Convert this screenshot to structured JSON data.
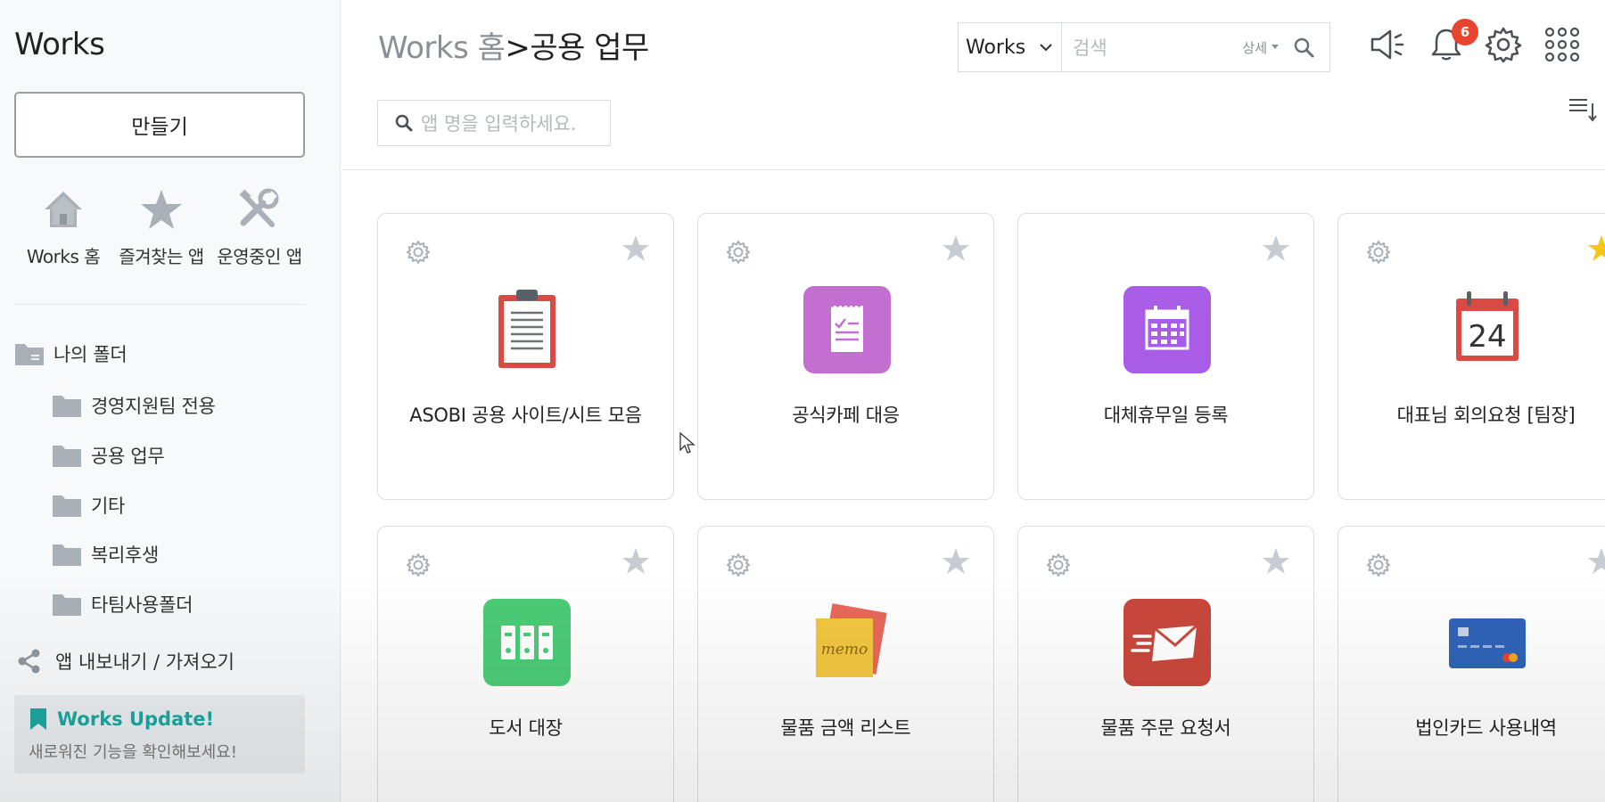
{
  "sidebar": {
    "app_title": "Works",
    "create_label": "만들기",
    "quick_nav": [
      {
        "label": "Works 홈",
        "icon": "home-icon"
      },
      {
        "label": "즐겨찾는 앱",
        "icon": "star-icon"
      },
      {
        "label": "운영중인 앱",
        "icon": "tools-icon"
      }
    ],
    "folders": [
      {
        "label": "나의 폴더",
        "icon": "folder-icon",
        "level": 0
      },
      {
        "label": "경영지원팀 전용",
        "icon": "folder-icon",
        "level": 1
      },
      {
        "label": "공용 업무",
        "icon": "folder-icon",
        "level": 1
      },
      {
        "label": "기타",
        "icon": "folder-icon",
        "level": 1
      },
      {
        "label": "복리후생",
        "icon": "folder-icon",
        "level": 1
      },
      {
        "label": "타팀사용폴더",
        "icon": "folder-icon",
        "level": 1
      }
    ],
    "share_label": "앱 내보내기 / 가져오기",
    "update": {
      "title": "Works Update!",
      "description": "새로워진 기능을 확인해보세요!"
    }
  },
  "header": {
    "breadcrumb_home": "Works 홈",
    "breadcrumb_separator": ">",
    "breadcrumb_current": "공용 업무",
    "search": {
      "scope": "Works",
      "placeholder": "검색",
      "detail_label": "상세"
    },
    "notification_count": "6",
    "app_search_placeholder": "앱 명을 입력하세요."
  },
  "apps": [
    {
      "name": "ASOBI 공용 사이트/시트 모음",
      "icon": "clipboard-icon",
      "starred": false,
      "has_settings": true
    },
    {
      "name": "공식카페 대응",
      "icon": "checklist-icon",
      "starred": false,
      "has_settings": true
    },
    {
      "name": "대체휴무일 등록",
      "icon": "calendar-grid-icon",
      "starred": false,
      "has_settings": false
    },
    {
      "name": "대표님 회의요청 [팀장]",
      "icon": "calendar-24-icon",
      "starred": true,
      "has_settings": true,
      "calendar_day": "24"
    },
    {
      "name": "도서 대장",
      "icon": "binders-icon",
      "starred": false,
      "has_settings": true
    },
    {
      "name": "물품 금액 리스트",
      "icon": "memo-icon",
      "starred": false,
      "has_settings": true,
      "memo_text": "memo"
    },
    {
      "name": "물품 주문 요청서",
      "icon": "mail-send-icon",
      "starred": false,
      "has_settings": true
    },
    {
      "name": "법인카드 사용내역",
      "icon": "credit-card-icon",
      "starred": false,
      "has_settings": true
    }
  ],
  "colors": {
    "accent_teal": "#1aa7a0",
    "badge_red": "#e8442f",
    "star_active": "#f5c518",
    "star_inactive": "#c6ccd2",
    "icon_purple_light": "#c36fd2",
    "icon_purple": "#a95de6",
    "icon_green": "#4ccb76",
    "icon_red": "#c9473c"
  }
}
